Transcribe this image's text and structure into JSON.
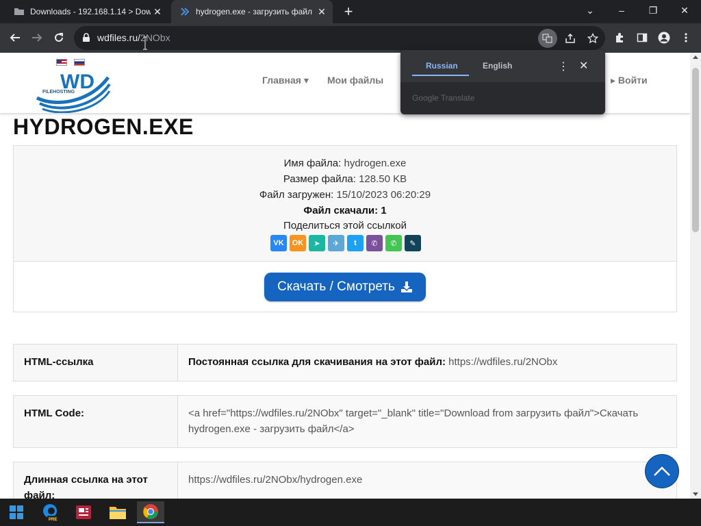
{
  "browser": {
    "tabs": [
      {
        "title": "Downloads - 192.168.1.14 > Dow",
        "active": false,
        "icon": "folder-icon"
      },
      {
        "title": "hydrogen.exe - загрузить файл",
        "active": true,
        "icon": "wdfiles-favicon"
      }
    ],
    "new_tab_label": "+",
    "window_controls": {
      "minimize": "–",
      "restore": "❐",
      "close": "✕",
      "tab_search": "⌄"
    },
    "url_host": "wdfiles.ru/",
    "url_path": "2NObx"
  },
  "translate_popup": {
    "lang_from": "Russian",
    "lang_to": "English",
    "brand": "Google Translate"
  },
  "site": {
    "flags": [
      "us-flag",
      "ru-flag"
    ],
    "logo_text": "WD",
    "logo_subtext": "FILEHOSTING",
    "nav": {
      "home": "Главная ▾",
      "my_files": "Мои файлы",
      "login": "▸ Войти"
    }
  },
  "file": {
    "title": "HYDROGEN.EXE",
    "name_label": "Имя файла:",
    "name_value": "hydrogen.exe",
    "size_label": "Размер файла:",
    "size_value": "128.50 KB",
    "uploaded_label": "Файл загружен:",
    "uploaded_value": "15/10/2023 06:20:29",
    "downloads_label": "Файл скачали:",
    "downloads_value": "1",
    "share_label": "Поделиться этой ссылкой",
    "share_buttons": [
      {
        "name": "vk-icon",
        "glyph": "VK",
        "color": "#2787f5"
      },
      {
        "name": "odnoklassniki-icon",
        "glyph": "OK",
        "color": "#f7931e"
      },
      {
        "name": "send-icon",
        "glyph": "➤",
        "color": "#1ab8a0"
      },
      {
        "name": "telegram-icon",
        "glyph": "✈",
        "color": "#5ca6d8"
      },
      {
        "name": "twitter-icon",
        "glyph": "t",
        "color": "#1da1f2"
      },
      {
        "name": "viber-icon",
        "glyph": "✆",
        "color": "#7b519d"
      },
      {
        "name": "whatsapp-icon",
        "glyph": "✆",
        "color": "#43c553"
      },
      {
        "name": "livejournal-icon",
        "glyph": "✎",
        "color": "#13435b"
      }
    ],
    "download_button": "Скачать / Смотреть"
  },
  "links": {
    "html_link_label": "HTML-ссылка",
    "html_link_prefix": "Постоянная ссылка для скачивания на этот файл:",
    "html_link_url": "https://wdfiles.ru/2NObx",
    "html_code_label": "HTML Code:",
    "html_code_value": "<a href=\"https://wdfiles.ru/2NObx\" target=\"_blank\" title=\"Download from загрузить файл\">Скачать hydrogen.exe - загрузить файл</a>",
    "long_link_label": "Длинная ссылка на этот файл:",
    "long_link_value": "https://wdfiles.ru/2NObx/hydrogen.exe"
  },
  "taskbar": {
    "apps": [
      "windows-start-icon",
      "edge-beta-icon",
      "news-app-icon",
      "file-explorer-icon",
      "chrome-icon"
    ],
    "edge_badge": "PRE"
  }
}
